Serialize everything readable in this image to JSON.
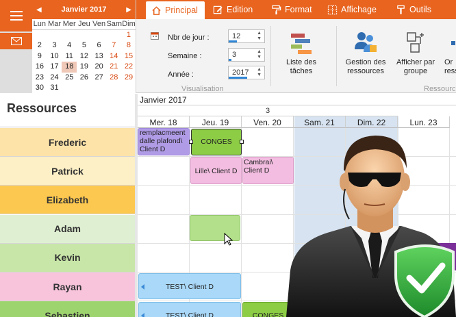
{
  "calendar": {
    "title": "Janvier 2017",
    "prev_icon": "triangle-left-icon",
    "next_icon": "triangle-right-icon",
    "dow": [
      "Lun",
      "Mar",
      "Mer",
      "Jeu",
      "Ven",
      "Sam",
      "Dim"
    ],
    "weeks": [
      [
        "",
        "",
        "",
        "",
        "",
        "",
        "1"
      ],
      [
        "2",
        "3",
        "4",
        "5",
        "6",
        "7",
        "8"
      ],
      [
        "9",
        "10",
        "11",
        "12",
        "13",
        "14",
        "15"
      ],
      [
        "16",
        "17",
        "18",
        "19",
        "20",
        "21",
        "22"
      ],
      [
        "23",
        "24",
        "25",
        "26",
        "27",
        "28",
        "29"
      ],
      [
        "30",
        "31",
        "",
        "",
        "",
        "",
        ""
      ]
    ],
    "today": "18"
  },
  "tabs": [
    {
      "label": "Principal",
      "icon": "home-icon"
    },
    {
      "label": "Edition",
      "icon": "edit-icon"
    },
    {
      "label": "Format",
      "icon": "paint-roller-icon"
    },
    {
      "label": "Affichage",
      "icon": "view-grid-icon"
    },
    {
      "label": "Outils",
      "icon": "tools-icon"
    }
  ],
  "visualisation": {
    "nb_jours_label": "Nbr de jour :",
    "nb_jours_value": "12",
    "semaine_label": "Semaine :",
    "semaine_value": "3",
    "annee_label": "Année :",
    "annee_value": "2017",
    "caption": "Visualisation"
  },
  "ribbon_buttons": {
    "liste_taches": "Liste des tâches",
    "gestion_ressources": "Gestion des ressources",
    "afficher_par_groupe": "Afficher par groupe",
    "partial_label": "Or",
    "partial_label2": "ress",
    "ressources_caption": "Ressource"
  },
  "resources": {
    "header": "Ressources",
    "items": [
      {
        "name": "Frederic",
        "color": "#fde3a8"
      },
      {
        "name": "Patrick",
        "color": "#fdf0c6"
      },
      {
        "name": "Elizabeth",
        "color": "#fdc84f"
      },
      {
        "name": "Adam",
        "color": "#dff0d2"
      },
      {
        "name": "Kevin",
        "color": "#c8e6a8"
      },
      {
        "name": "Rayan",
        "color": "#f8c4dc"
      },
      {
        "name": "Sebastien",
        "color": "#9ed46e"
      }
    ]
  },
  "schedule": {
    "month": "Janvier 2017",
    "week_number": "3",
    "days": [
      "Mer. 18",
      "Jeu. 19",
      "Ven. 20",
      "Sam. 21",
      "Dim. 22",
      "Lun. 23"
    ],
    "events": {
      "frederic_1": "remplacmeent dalle plafond\\ Client D",
      "frederic_2": "CONGES",
      "patrick_1": "Lille\\ Client D",
      "patrick_2": "Cambrai\\ Client D",
      "rayan_1": "TEST\\ Client D",
      "sebastien_1": "TEST\\ Client D",
      "sebastien_2": "CONGES"
    }
  },
  "overlay": {
    "icon": "secure-agent-shield-icon"
  }
}
